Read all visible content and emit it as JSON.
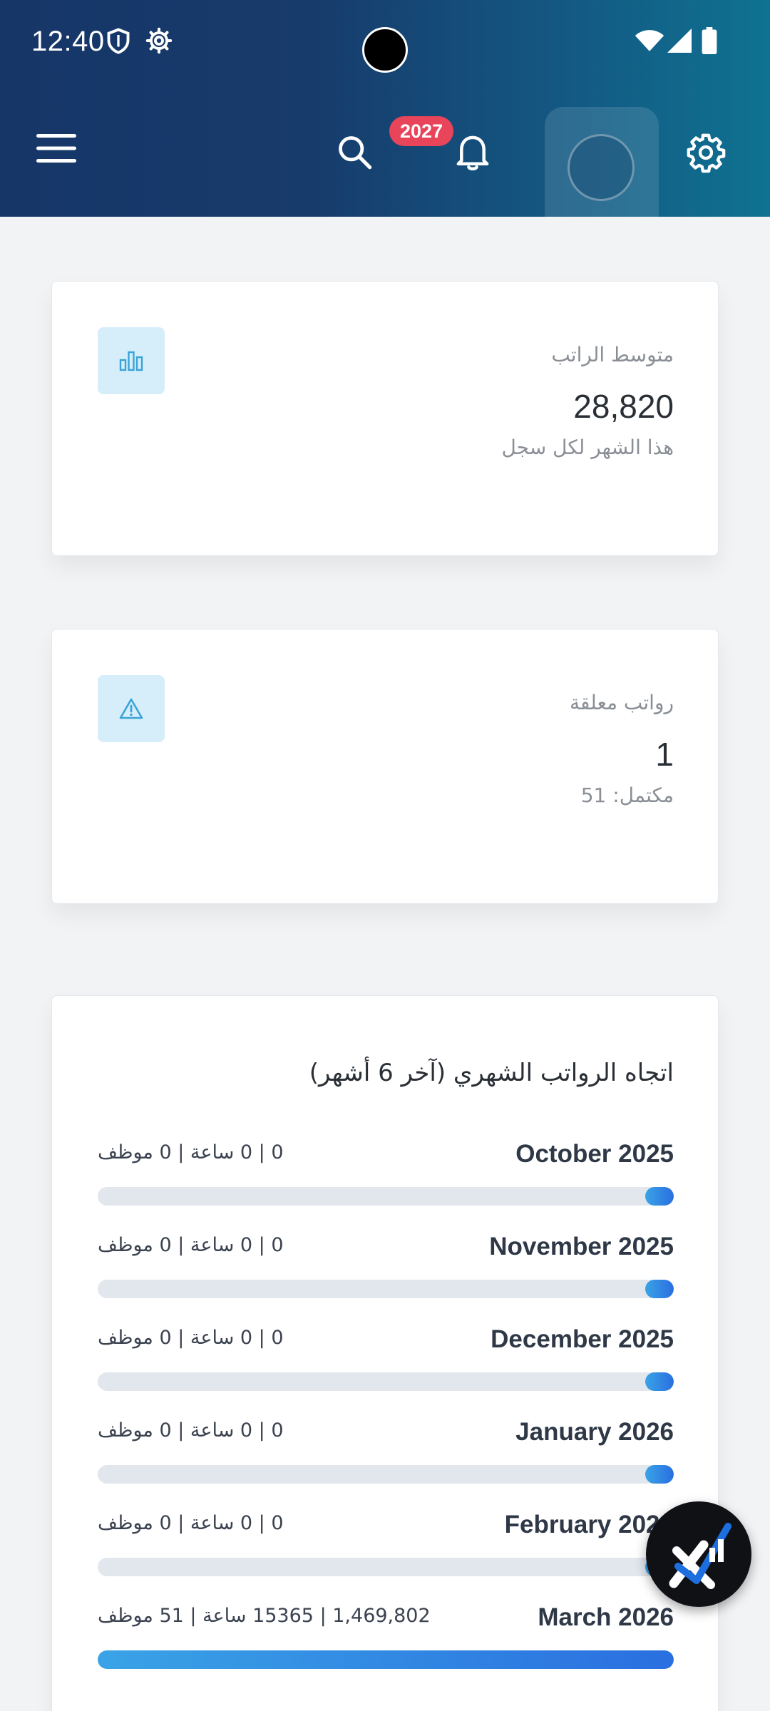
{
  "status_bar": {
    "time": "12:40",
    "icons": [
      "shield-icon",
      "gear-icon",
      "wifi-icon",
      "signal-icon",
      "battery-icon"
    ]
  },
  "toolbar": {
    "icons": [
      "menu-icon",
      "search-icon",
      "bell-icon",
      "avatar",
      "settings-icon"
    ],
    "notification_count": "2027"
  },
  "cards": {
    "avg_salary": {
      "label": "متوسط الراتب",
      "value": "28,820",
      "subtitle": "هذا الشهر لكل سجل",
      "icon": "bar-chart-icon"
    },
    "pending_salaries": {
      "label": "رواتب معلقة",
      "value": "1",
      "subtitle": "مكتمل: 51",
      "icon": "warning-icon"
    }
  },
  "trend": {
    "title": "اتجاه الرواتب الشهري (آخر 6 أشهر)",
    "months": [
      {
        "name": "October 2025",
        "meta": "0 | 0 ساعة | 0 موظف",
        "fill": 0.05
      },
      {
        "name": "November 2025",
        "meta": "0 | 0 ساعة | 0 موظف",
        "fill": 0.05
      },
      {
        "name": "December 2025",
        "meta": "0 | 0 ساعة | 0 موظف",
        "fill": 0.05
      },
      {
        "name": "January 2026",
        "meta": "0 | 0 ساعة | 0 موظف",
        "fill": 0.05
      },
      {
        "name": "February 2026",
        "meta": "0 | 0 ساعة | 0 موظف",
        "fill": 0.05
      },
      {
        "name": "March 2026",
        "meta": "1,469,802 | 15365 ساعة | 51 موظف",
        "fill": 1.0
      }
    ]
  },
  "colors": {
    "header_start": "#163668",
    "header_end": "#0f7291",
    "badge": "#e8445a",
    "bar_fill": "#2a6fe0",
    "bar_track": "#e2e7ee"
  }
}
